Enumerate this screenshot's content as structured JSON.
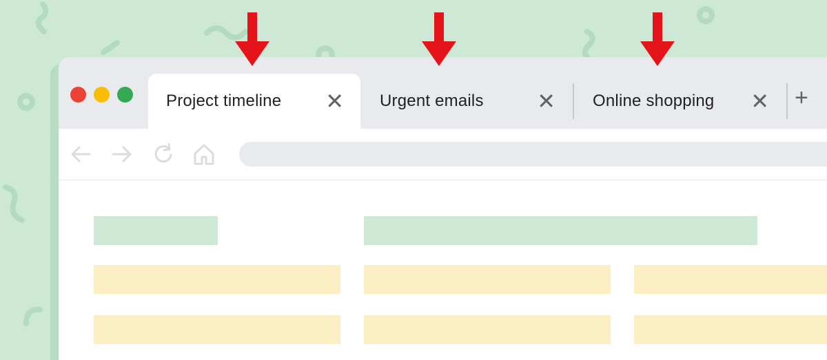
{
  "tabs": [
    {
      "label": "Project timeline",
      "active": true
    },
    {
      "label": "Urgent emails",
      "active": false
    },
    {
      "label": "Online shopping",
      "active": false
    }
  ],
  "tab_close_glyph": "✕",
  "new_tab_glyph": "+",
  "traffic_lights": [
    "#ea4335",
    "#fbbc04",
    "#34a853"
  ],
  "colors": {
    "background": "#cde9d6",
    "arrow": "#e5141b",
    "placeholder_green": "#cde9d6",
    "placeholder_yellow": "#fdefc4"
  },
  "icons": [
    "back-arrow-icon",
    "forward-arrow-icon",
    "reload-icon",
    "home-icon",
    "close-icon",
    "plus-icon"
  ]
}
